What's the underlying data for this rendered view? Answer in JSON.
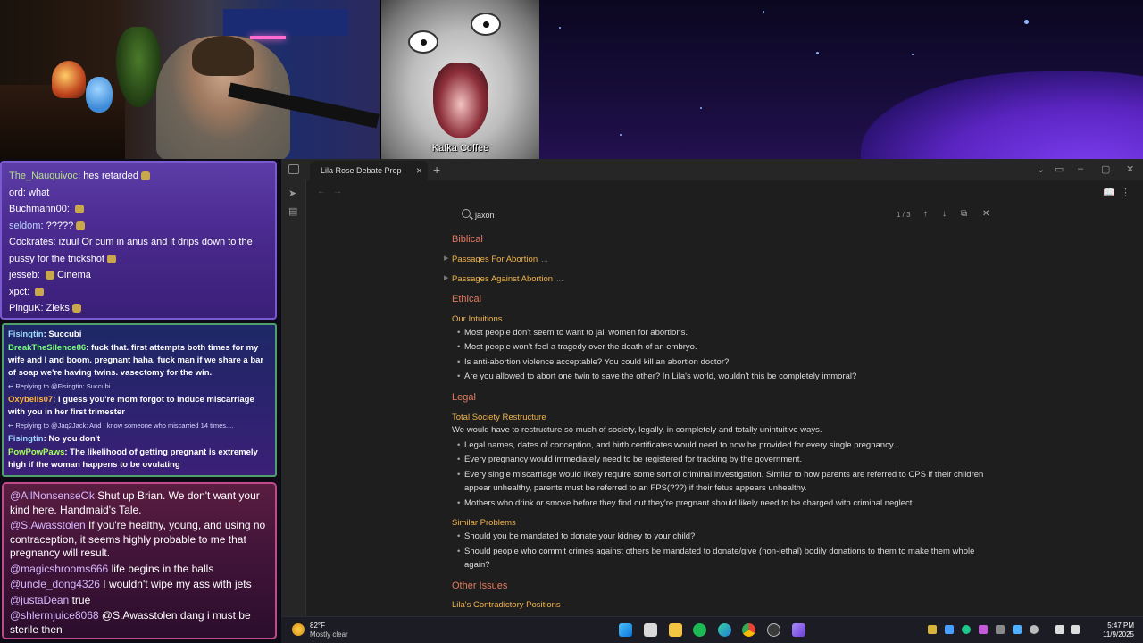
{
  "stream": {
    "overlay_caption": "Kafka Coffee"
  },
  "chat_top": [
    {
      "user": "The_Nauquivoc",
      "text": "hes retarded",
      "ucolor": "green"
    },
    {
      "user": "ord",
      "text": "what",
      "ucolor": "white"
    },
    {
      "user": "Buchmann00",
      "text": "",
      "ucolor": "white"
    },
    {
      "user": "seldom",
      "text": "?????",
      "ucolor": "blue"
    },
    {
      "user": "Cockrates",
      "text": "izuul Or cum in anus and it drips down to the",
      "ucolor": "white"
    },
    {
      "user": "",
      "text": "pussy for the trickshot",
      "ucolor": "white"
    },
    {
      "user": "jesseb",
      "text": "Cinema",
      "ucolor": "white"
    },
    {
      "user": "xpct",
      "text": "",
      "ucolor": "white"
    },
    {
      "user": "PinguK",
      "text": "Zieks",
      "ucolor": "white"
    }
  ],
  "chat_mid": [
    {
      "user": "Fisingtin",
      "text": "Succubi",
      "ucolor": "cyan"
    },
    {
      "user": "BreakTheSilence86",
      "text": "fuck that. first attempts both times for my wife and I and boom. pregnant haha. fuck man if we share a bar of soap we're having twins. vasectomy for the win.",
      "ucolor": "green"
    },
    {
      "reply": "Replying to @Fisingtin: Succubi"
    },
    {
      "user": "Oxybelis07",
      "text": "I guess you're mom forgot to induce miscarriage with you in her first trimester",
      "ucolor": "orange"
    },
    {
      "reply": "Replying to @Jaq2Jack: And I know someone who miscarried 14 times...."
    },
    {
      "user": "Fisingtin",
      "text": "No you don't",
      "ucolor": "cyan"
    },
    {
      "user": "PowPowPaws",
      "text": "The likelihood of getting pregnant is extremely high if the woman happens to be ovulating",
      "ucolor": "lime"
    }
  ],
  "chat_bottom": [
    {
      "user": "@AllNonsenseOk",
      "text": "Shut up Brian. We don't want your kind here. Handmaid's Tale."
    },
    {
      "user": "@S.Awasstolen",
      "text": "If you're healthy, young, and using no contraception, it seems highly probable to me that pregnancy will result."
    },
    {
      "user": "@magicshrooms666",
      "text": "life begins in the balls"
    },
    {
      "user": "@uncle_dong4326",
      "text": "I wouldn't wipe my ass with jets"
    },
    {
      "user": "@justaDean",
      "text": "true"
    },
    {
      "user": "@shlermjuice8068",
      "text": "@S.Awasstolen dang i must be sterile then"
    }
  ],
  "app": {
    "tab_title": "Lila Rose Debate Prep",
    "search": {
      "query": "jaxon",
      "count": "1 / 3"
    }
  },
  "doc": {
    "biblical": "Biblical",
    "passages_for": "Passages For Abortion",
    "passages_against": "Passages Against Abortion",
    "ellipsis": "...",
    "ethical": "Ethical",
    "our_intuitions": "Our Intuitions",
    "intuitions": [
      "Most people don't seem to want to jail women for abortions.",
      "Most people won't feel a tragedy over the death of an embryo.",
      "Is anti-abortion violence acceptable? You could kill an abortion doctor?",
      "Are you allowed to abort one twin to save the other? In Lila's world, wouldn't this be completely immoral?"
    ],
    "legal": "Legal",
    "total_restructure": "Total Society Restructure",
    "restructure_intro": "We would have to restructure so much of society, legally, in completely and totally unintuitive ways.",
    "restructure": [
      "Legal names, dates of conception, and birth certificates would need to now be provided for every single pregnancy.",
      "Every pregnancy would immediately need to be registered for tracking by the government.",
      "Every single miscarriage would likely require some sort of criminal investigation. Similar to how parents are referred to CPS if their children appear unhealthy, parents must be referred to an FPS(???) if their fetus appears unhealthy.",
      "Mothers who drink or smoke before they find out they're pregnant should likely need to be charged with criminal neglect."
    ],
    "similar_problems": "Similar Problems",
    "similar": [
      "Should you be mandated to donate your kidney to your child?",
      "Should people who commit crimes against others be mandated to donate/give (non-lethal) bodily donations to them to make them whole again?"
    ],
    "other_issues": "Other Issues",
    "contradictory": "Lila's Contradictory Positions"
  },
  "taskbar": {
    "temp": "82°F",
    "weather": "Mostly clear",
    "time": "5:47 PM",
    "date": "11/9/2025"
  },
  "colors": {
    "heading": "#e07a5f",
    "subheading": "#f0b44a",
    "editor_bg": "#1e1e1e"
  }
}
